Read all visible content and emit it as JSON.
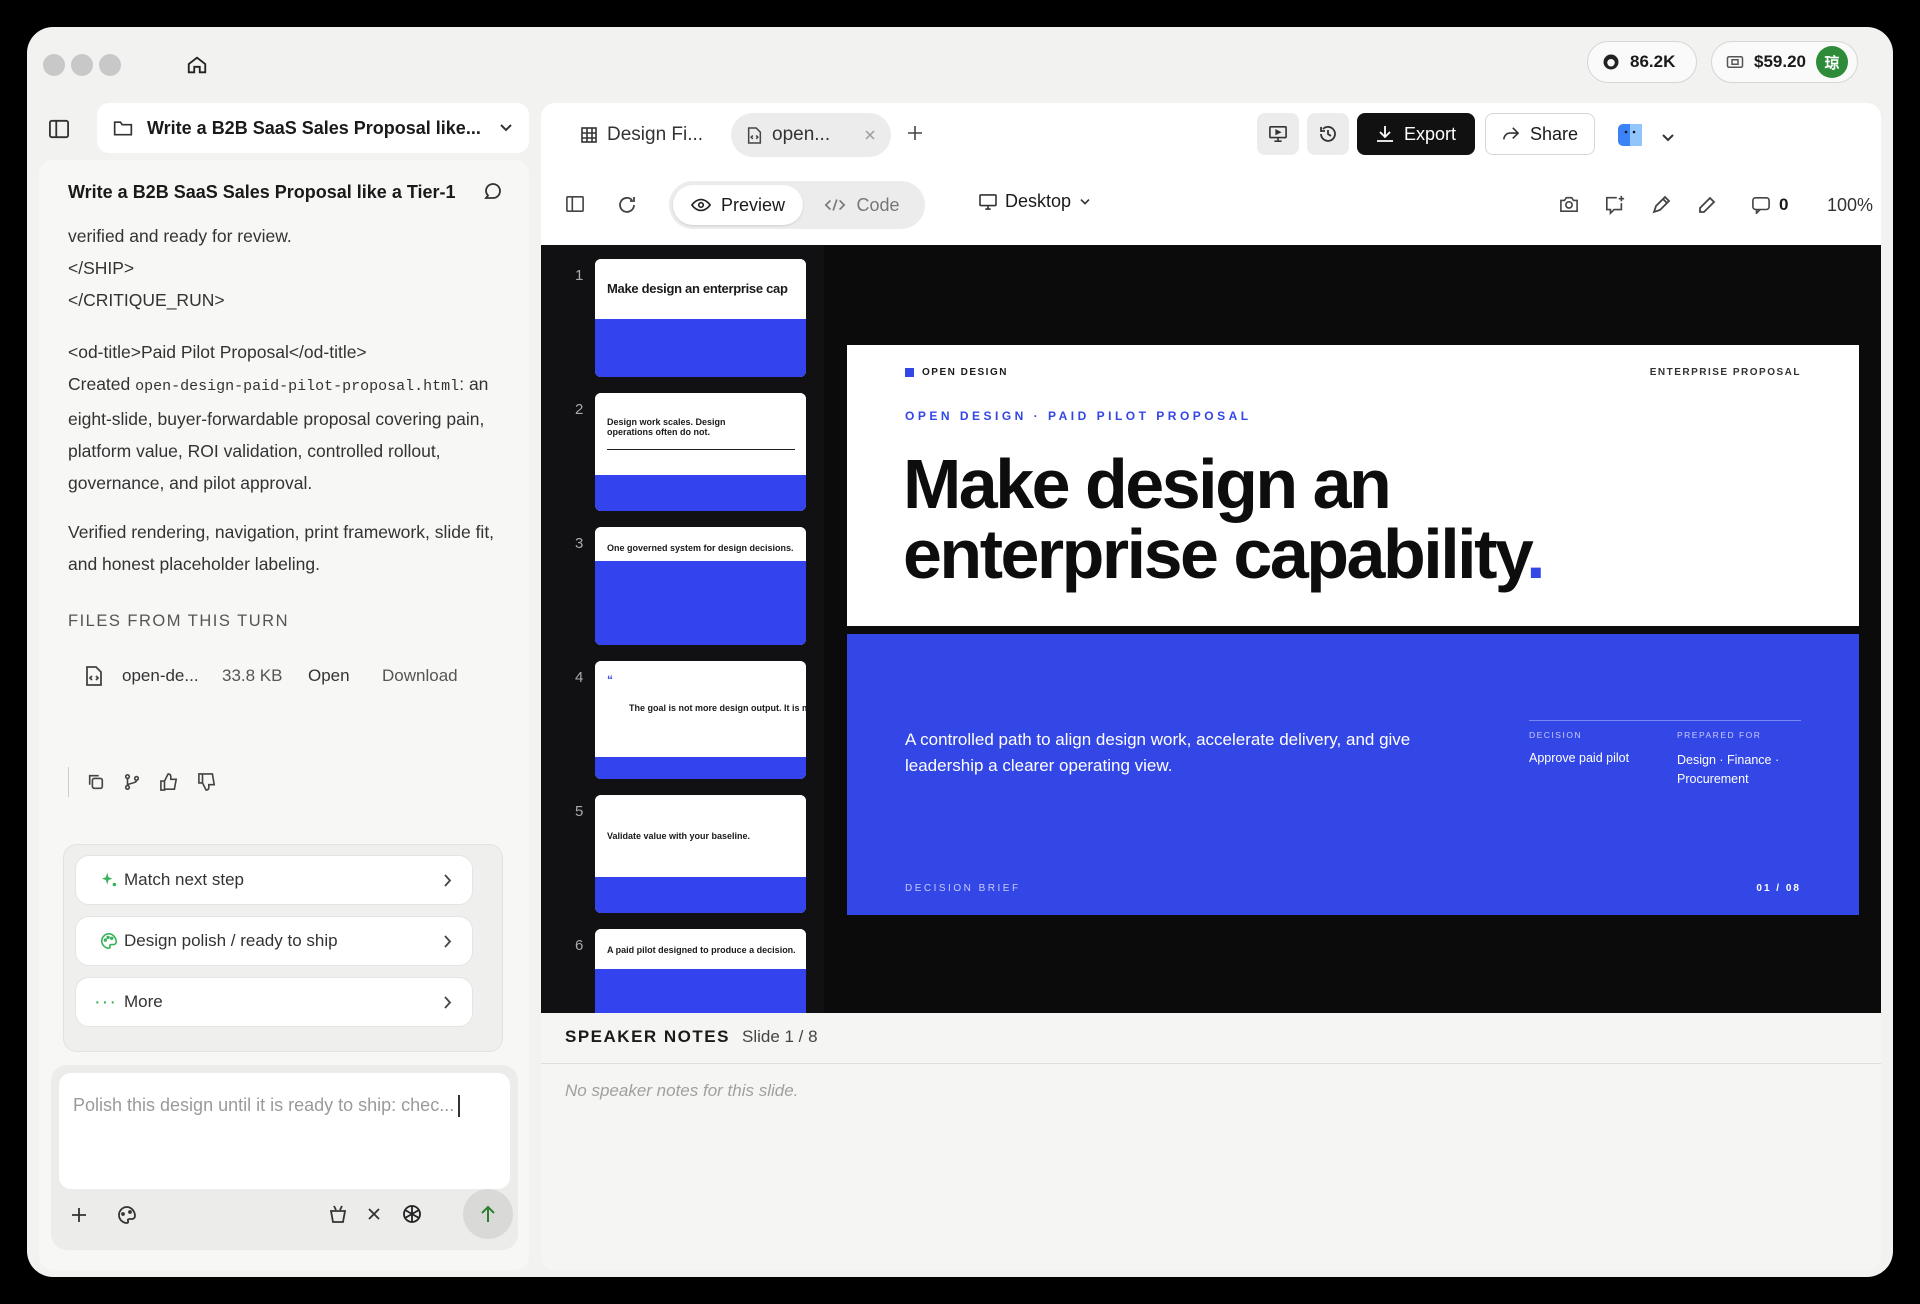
{
  "titlebar": {
    "github_stars": "86.2K",
    "balance": "$59.20",
    "avatar_char": "琼"
  },
  "chat": {
    "header_title": "Write a B2B SaaS Sales Proposal like...",
    "conversation_title": "Write a B2B SaaS Sales Proposal like a Tier-1",
    "lines": [
      "verified and ready for review.",
      "</SHIP>",
      "</CRITIQUE_RUN>"
    ],
    "od_title": "<od-title>Paid Pilot Proposal</od-title>",
    "created_prefix": "Created ",
    "created_file": "open-design-paid-pilot-proposal.html",
    "created_suffix": ":",
    "created_desc": "an eight-slide, buyer-forwardable proposal covering pain, platform value, ROI validation, controlled rollout, governance, and pilot approval.",
    "verified": "Verified rendering, navigation, print framework, slide fit, and honest placeholder labeling.",
    "files_heading": "FILES FROM THIS TURN",
    "file": {
      "name": "open-de...",
      "size": "33.8 KB",
      "open": "Open",
      "download": "Download"
    },
    "suggestions": [
      {
        "label": "Match next step"
      },
      {
        "label": "Design polish / ready to ship"
      },
      {
        "label": "More"
      }
    ],
    "input_placeholder": "Polish this design until it is ready to ship: chec..."
  },
  "workspace": {
    "tabs": [
      {
        "label": "Design Fi..."
      },
      {
        "label": "open..."
      }
    ],
    "export_label": "Export",
    "share_label": "Share",
    "view_toggle": {
      "preview": "Preview",
      "code": "Code",
      "selected": "preview"
    },
    "device": "Desktop",
    "comment_count": "0",
    "zoom": "100%"
  },
  "thumbnails": [
    {
      "num": "1",
      "title": "Make design an enterprise cap"
    },
    {
      "num": "2",
      "title": "Design work scales. Design operations often do not."
    },
    {
      "num": "3",
      "title": "One governed system for design decisions."
    },
    {
      "num": "4",
      "title": "The goal is not more design output. It is m"
    },
    {
      "num": "5",
      "title": "Validate value with your baseline."
    },
    {
      "num": "6",
      "title": "A paid pilot designed to produce a decision."
    }
  ],
  "slide": {
    "brand": "OPEN DESIGN",
    "tag": "ENTERPRISE PROPOSAL",
    "eyebrow": "OPEN DESIGN · PAID PILOT PROPOSAL",
    "headline_1": "Make design an",
    "headline_2": "enterprise capability",
    "headline_dot": ".",
    "subtitle": "A controlled path to align design work, accelerate delivery, and give leadership a clearer operating view.",
    "decision_label": "DECISION",
    "decision_value": "Approve paid pilot",
    "prepared_label": "PREPARED FOR",
    "prepared_value": "Design · Finance · Procurement",
    "footer_left": "DECISION BRIEF",
    "footer_right": "01 / 08",
    "accent": "#3346e6"
  },
  "notes": {
    "heading": "SPEAKER NOTES",
    "slide_label": "Slide 1 / 8",
    "empty": "No speaker notes for this slide."
  }
}
